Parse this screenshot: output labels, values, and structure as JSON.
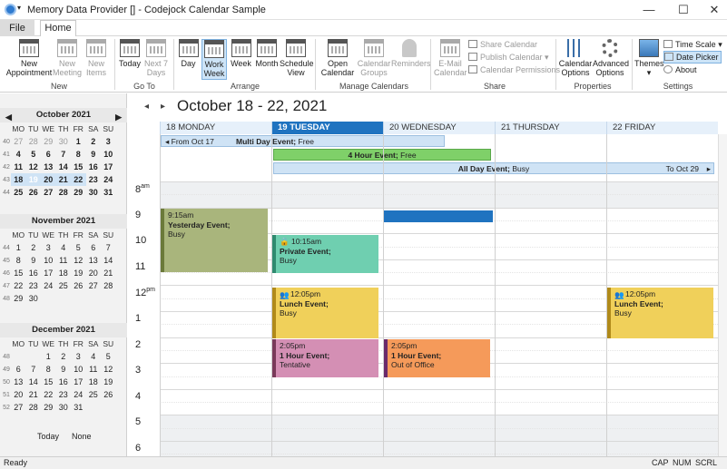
{
  "window": {
    "title": "Memory Data Provider [] - Codejock Calendar Sample",
    "min": "—",
    "max": "☐",
    "close": "✕"
  },
  "tabs": {
    "file": "File",
    "home": "Home"
  },
  "ribbon": {
    "new_group": "New",
    "new_appointment": "New\nAppointment",
    "new_meeting": "New\nMeeting",
    "new_items": "New\nItems",
    "goto_group": "Go To",
    "today": "Today",
    "next7": "Next 7\nDays",
    "arrange_group": "Arrange",
    "day": "Day",
    "workweek": "Work\nWeek",
    "week": "Week",
    "month": "Month",
    "schedule": "Schedule\nView",
    "manage_group": "Manage Calendars",
    "open_calendar": "Open\nCalendar",
    "calendar_groups": "Calendar\nGroups",
    "reminders": "Reminders",
    "share_group": "Share",
    "email_calendar": "E-Mail\nCalendar",
    "share_calendar": "Share Calendar",
    "publish_calendar": "Publish Calendar",
    "calendar_permissions": "Calendar Permissions",
    "properties_group": "Properties",
    "calendar_options": "Calendar\nOptions",
    "advanced_options": "Advanced\nOptions",
    "settings_group": "Settings",
    "themes": "Themes",
    "time_scale": "Time Scale",
    "date_picker": "Date Picker",
    "about": "About"
  },
  "minicals": [
    {
      "title": "October 2021",
      "rows": [
        [
          "40",
          "27",
          "28",
          "29",
          "30",
          "1",
          "2",
          "3"
        ],
        [
          "41",
          "4",
          "5",
          "6",
          "7",
          "8",
          "9",
          "10"
        ],
        [
          "42",
          "11",
          "12",
          "13",
          "14",
          "15",
          "16",
          "17"
        ],
        [
          "43",
          "18",
          "19",
          "20",
          "21",
          "22",
          "23",
          "24"
        ],
        [
          "44",
          "25",
          "26",
          "27",
          "28",
          "29",
          "30",
          "31"
        ]
      ]
    },
    {
      "title": "November 2021",
      "rows": [
        [
          "44",
          "1",
          "2",
          "3",
          "4",
          "5",
          "6",
          "7"
        ],
        [
          "45",
          "8",
          "9",
          "10",
          "11",
          "12",
          "13",
          "14"
        ],
        [
          "46",
          "15",
          "16",
          "17",
          "18",
          "19",
          "20",
          "21"
        ],
        [
          "47",
          "22",
          "23",
          "24",
          "25",
          "26",
          "27",
          "28"
        ],
        [
          "48",
          "29",
          "30",
          "",
          "",
          "",
          "",
          ""
        ]
      ]
    },
    {
      "title": "December 2021",
      "rows": [
        [
          "48",
          "",
          "",
          "1",
          "2",
          "3",
          "4",
          "5"
        ],
        [
          "49",
          "6",
          "7",
          "8",
          "9",
          "10",
          "11",
          "12"
        ],
        [
          "50",
          "13",
          "14",
          "15",
          "16",
          "17",
          "18",
          "19"
        ],
        [
          "51",
          "20",
          "21",
          "22",
          "23",
          "24",
          "25",
          "26"
        ],
        [
          "52",
          "27",
          "28",
          "29",
          "30",
          "31",
          "",
          ""
        ]
      ]
    }
  ],
  "weekdays": [
    "MO",
    "TU",
    "WE",
    "TH",
    "FR",
    "SA",
    "SU"
  ],
  "minical_footer": {
    "today": "Today",
    "none": "None"
  },
  "calendar": {
    "range": "October 18 - 22, 2021",
    "days": [
      "18 MONDAY",
      "19 TUESDAY",
      "20 WEDNESDAY",
      "21 THURSDAY",
      "22 FRIDAY"
    ],
    "times": [
      {
        "h": "8",
        "s": "am"
      },
      {
        "h": "9",
        "s": ""
      },
      {
        "h": "10",
        "s": ""
      },
      {
        "h": "11",
        "s": ""
      },
      {
        "h": "12",
        "s": "pm"
      },
      {
        "h": "1",
        "s": ""
      },
      {
        "h": "2",
        "s": ""
      },
      {
        "h": "3",
        "s": ""
      },
      {
        "h": "4",
        "s": ""
      },
      {
        "h": "5",
        "s": ""
      },
      {
        "h": "6",
        "s": ""
      }
    ],
    "allday": [
      {
        "from": "From Oct 17",
        "title": "Multi Day Event;",
        "status": "Free"
      },
      {
        "title": "4 Hour Event;",
        "status": "Free"
      },
      {
        "title": "All Day Event;",
        "status": "Busy",
        "to": "To Oct 29"
      }
    ],
    "events": {
      "yesterday": {
        "time": "9:15am",
        "title": "Yesterday Event;",
        "status": "Busy"
      },
      "private": {
        "time": "10:15am",
        "title": "Private Event;",
        "status": "Busy"
      },
      "lunch_tue": {
        "time": "12:05pm",
        "title": "Lunch Event;",
        "status": "Busy"
      },
      "lunch_fri": {
        "time": "12:05pm",
        "title": "Lunch Event;",
        "status": "Busy"
      },
      "hour_tue": {
        "time": "2:05pm",
        "title": "1 Hour Event;",
        "status": "Tentative"
      },
      "hour_wed": {
        "time": "2:05pm",
        "title": "1 Hour Event;",
        "status": "Out of Office"
      }
    }
  },
  "status": {
    "ready": "Ready",
    "cap": "CAP",
    "num": "NUM",
    "scrl": "SCRL"
  },
  "colors": {
    "accent": "#1f73c0",
    "yesterday": "#a9b57c",
    "private": "#6fcfb0",
    "lunch": "#f0d05a",
    "tentative": "#d48fb4",
    "outofoffice": "#f59a5a",
    "allday": "#cfe3f5",
    "fourhour": "#7fd069"
  }
}
